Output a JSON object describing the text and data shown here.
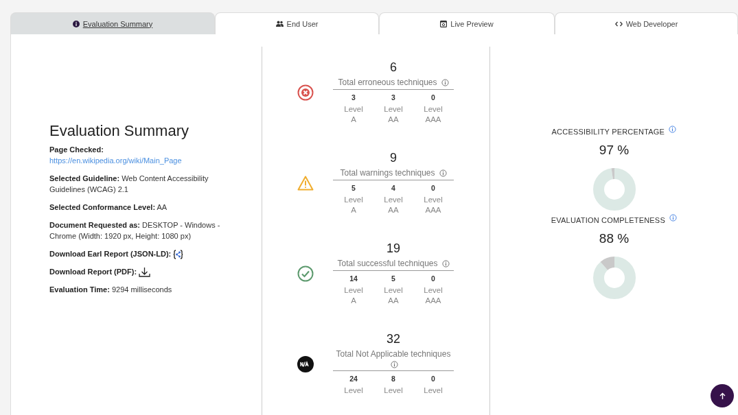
{
  "tabs": [
    {
      "label": "Evaluation Summary",
      "kind": "info",
      "selected": true
    },
    {
      "label": "End User",
      "kind": "users",
      "selected": false
    },
    {
      "label": "Live Preview",
      "kind": "preview",
      "selected": false
    },
    {
      "label": "Web Developer",
      "kind": "code",
      "selected": false
    }
  ],
  "summary": {
    "title": "Evaluation Summary",
    "fields": [
      {
        "label": "Page Checked:",
        "value": "https://en.wikipedia.org/wiki/Main_Page",
        "kind": "link"
      },
      {
        "label": "Selected Guideline:",
        "value": "Web Content Accessibility Guidelines (WCAG) 2.1",
        "kind": "text"
      },
      {
        "label": "Selected Conformance Level:",
        "value": "AA",
        "kind": "text"
      },
      {
        "label": "Document Requested as:",
        "value": "DESKTOP - Windows - Chrome (Width: 1920 px, Height: 1080 px)",
        "kind": "text"
      },
      {
        "label": "Download Earl Report (JSON-LD):",
        "kind": "json_download"
      },
      {
        "label": "Download Report (PDF):",
        "kind": "pdf_download"
      },
      {
        "label": "Evaluation Time:",
        "value": "9294 milliseconds",
        "kind": "text"
      }
    ]
  },
  "results": [
    {
      "kind": "error",
      "total": "6",
      "label": "Total erroneous techniques",
      "levels": [
        {
          "count": "3",
          "name": "Level A"
        },
        {
          "count": "3",
          "name": "Level AA"
        },
        {
          "count": "0",
          "name": "Level AAA"
        }
      ]
    },
    {
      "kind": "warning",
      "total": "9",
      "label": "Total warnings techniques",
      "levels": [
        {
          "count": "5",
          "name": "Level A"
        },
        {
          "count": "4",
          "name": "Level AA"
        },
        {
          "count": "0",
          "name": "Level AAA"
        }
      ]
    },
    {
      "kind": "success",
      "total": "19",
      "label": "Total successful techniques",
      "levels": [
        {
          "count": "14",
          "name": "Level A"
        },
        {
          "count": "5",
          "name": "Level AA"
        },
        {
          "count": "0",
          "name": "Level AAA"
        }
      ]
    },
    {
      "kind": "na",
      "total": "32",
      "label": "Total Not Applicable techniques",
      "levels": [
        {
          "count": "24",
          "name": "Level"
        },
        {
          "count": "8",
          "name": "Level"
        },
        {
          "count": "0",
          "name": "Level"
        }
      ]
    }
  ],
  "metrics": [
    {
      "label": "ACCESSIBILITY PERCENTAGE",
      "value": "97 %"
    },
    {
      "label": "EVALUATION COMPLETENESS",
      "value": "88 %"
    }
  ]
}
